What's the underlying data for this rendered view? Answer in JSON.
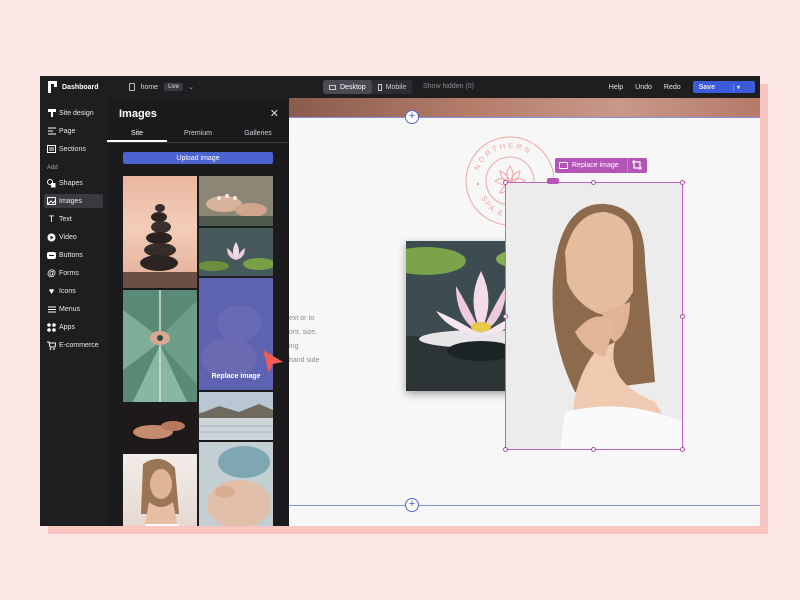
{
  "topbar": {
    "title": "Dashboard",
    "page_name": "home",
    "live_badge": "Live",
    "device_desktop": "Desktop",
    "device_mobile": "Mobile",
    "show_hidden": "Show hidden (0)",
    "help": "Help",
    "undo": "Undo",
    "redo": "Redo",
    "save": "Save"
  },
  "leftnav": {
    "items_top": [
      {
        "label": "Site design",
        "icon": "brush-icon"
      },
      {
        "label": "Page",
        "icon": "page-layout-icon"
      },
      {
        "label": "Sections",
        "icon": "sections-icon"
      }
    ],
    "add_label": "Add",
    "items_add": [
      {
        "label": "Shapes",
        "icon": "shapes-icon"
      },
      {
        "label": "Images",
        "icon": "image-icon",
        "active": true
      },
      {
        "label": "Text",
        "icon": "text-icon"
      },
      {
        "label": "Video",
        "icon": "play-icon"
      },
      {
        "label": "Buttons",
        "icon": "button-icon"
      },
      {
        "label": "Forms",
        "icon": "at-icon"
      },
      {
        "label": "Icons",
        "icon": "heart-icon"
      },
      {
        "label": "Menus",
        "icon": "menu-icon"
      },
      {
        "label": "Apps",
        "icon": "apps-icon"
      },
      {
        "label": "E-commerce",
        "icon": "cart-icon"
      }
    ]
  },
  "panel": {
    "title": "Images",
    "tabs": [
      "Site",
      "Premium",
      "Galleries"
    ],
    "active_tab": "Site",
    "upload_label": "Upload image",
    "hover_label": "Replace image"
  },
  "canvas": {
    "body_text": [
      "ext or to",
      "ont, size,",
      "ing",
      "hand side"
    ],
    "logo_text_top": "NORTHERN",
    "logo_text_bottom": "SPA & RESORT",
    "replace_badge": "Replace image"
  },
  "colors": {
    "accent": "#4c63d2",
    "selection": "#b554b8",
    "background": "#fde8e6",
    "logo": "#f1a7a2"
  }
}
